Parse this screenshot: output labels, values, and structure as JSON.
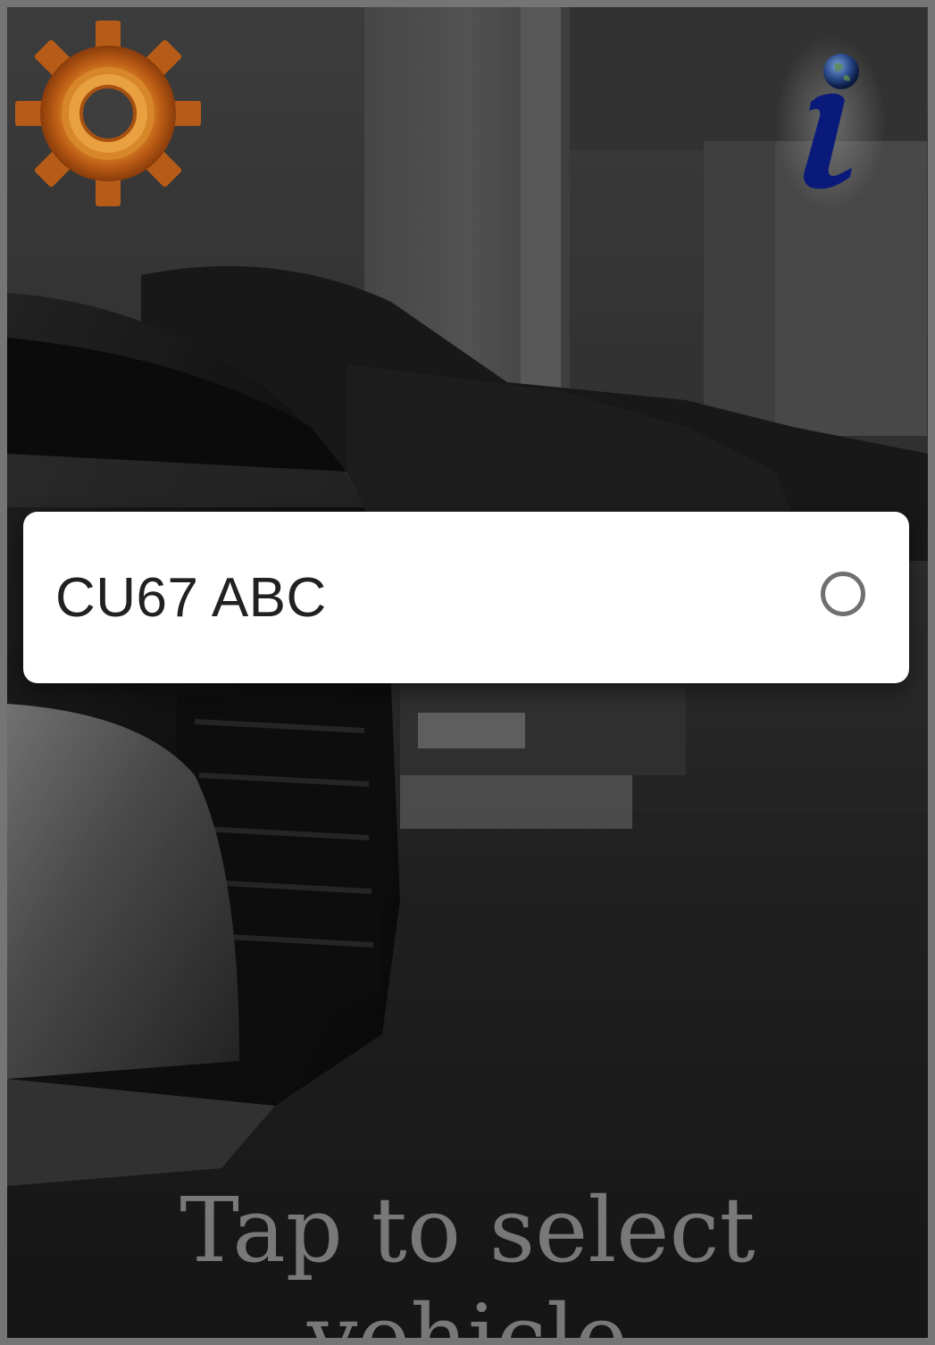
{
  "screen": {
    "hint_text": "Tap to select vehicle"
  },
  "toolbar": {
    "settings_icon": "gear-icon",
    "info_icon": "info-globe-icon"
  },
  "vehicle_picker": {
    "options": [
      {
        "label": "CU67 ABC",
        "selected": false
      }
    ]
  },
  "colors": {
    "gear_orange": "#c8661a",
    "info_navy": "#0a1a7a",
    "dialog_bg": "#ffffff",
    "radio_border": "#707070"
  }
}
